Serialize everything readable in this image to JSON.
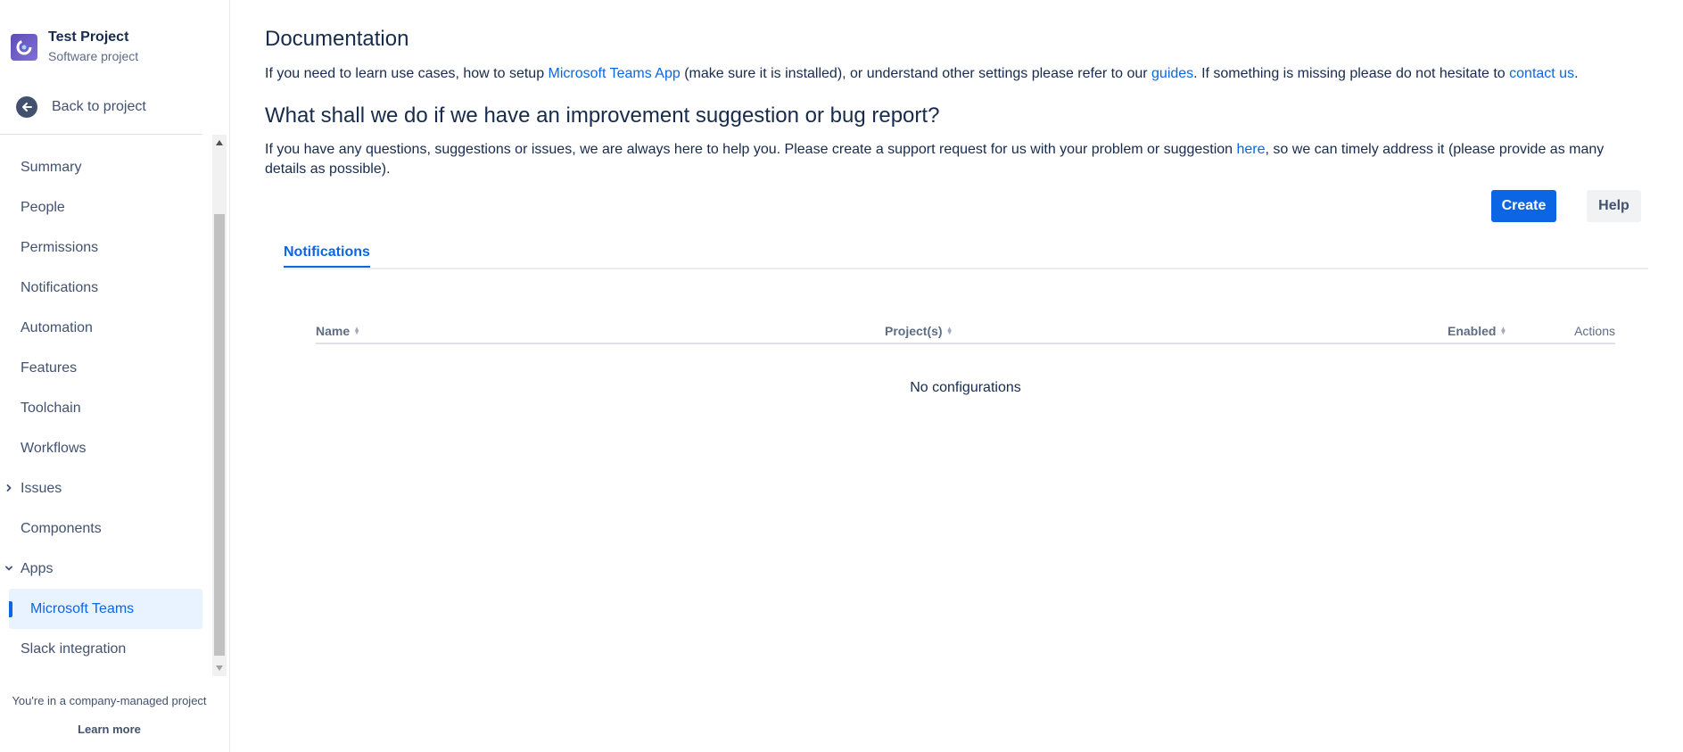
{
  "sidebar": {
    "project_name": "Test Project",
    "project_type": "Software project",
    "back_label": "Back to project",
    "items": [
      {
        "label": "Summary"
      },
      {
        "label": "People"
      },
      {
        "label": "Permissions"
      },
      {
        "label": "Notifications"
      },
      {
        "label": "Automation"
      },
      {
        "label": "Features"
      },
      {
        "label": "Toolchain"
      },
      {
        "label": "Workflows"
      },
      {
        "label": "Issues",
        "chevron": "right"
      },
      {
        "label": "Components"
      },
      {
        "label": "Apps",
        "chevron": "down"
      },
      {
        "label": "Microsoft Teams",
        "active": true
      },
      {
        "label": "Slack integration"
      }
    ],
    "footer_note": "You're in a company-managed project",
    "footer_link": "Learn more"
  },
  "main": {
    "doc_title": "Documentation",
    "doc_text_1": "If you need to learn use cases, how to setup ",
    "doc_link_1": "Microsoft Teams App",
    "doc_text_2": " (make sure it is installed), or understand other settings please refer to our ",
    "doc_link_2": "guides",
    "doc_text_3": ". If something is missing please do not hesitate to ",
    "doc_link_3": "contact us",
    "doc_text_4": ".",
    "sub_title": "What shall we do if we have an improvement suggestion or bug report?",
    "sup_text_1": "If you have any questions, suggestions or issues, we are always here to help you. Please create a support request for us with your problem or suggestion ",
    "sup_link": "here",
    "sup_text_2": ", so we can timely address it (please provide as many details as possible).",
    "create_label": "Create",
    "help_label": "Help",
    "tab_label": "Notifications",
    "table": {
      "columns": [
        "Name",
        "Project(s)",
        "Enabled",
        "Actions"
      ],
      "empty_text": "No configurations"
    }
  },
  "colors": {
    "accent": "#0c66e4",
    "text": "#172b4d",
    "subtle": "#42526e",
    "active_bg": "#e9f2ff"
  },
  "icons": {
    "project_avatar": "project-avatar-icon",
    "back": "arrow-left-icon",
    "chevron_right": "chevron-right-icon",
    "chevron_down": "chevron-down-icon",
    "sort": "sort-icon"
  }
}
